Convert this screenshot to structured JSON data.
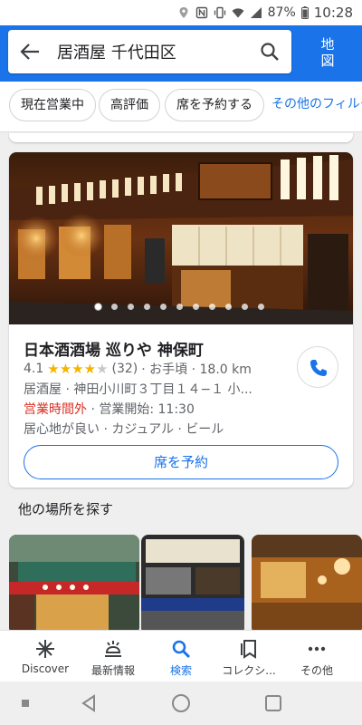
{
  "status_bar": {
    "battery": "87%",
    "time": "10:28"
  },
  "search": {
    "query": "居酒屋 千代田区"
  },
  "map_button": {
    "line1": "地",
    "line2": "図"
  },
  "filters": [
    "現在営業中",
    "高評価",
    "席を予約する",
    "その他のフィルタ"
  ],
  "result": {
    "name": "日本酒酒場 巡りや 神保町",
    "rating": "4.1",
    "rating_value": 4.1,
    "reviews": "(32)",
    "price": "· お手頃 · 18.0 km",
    "category_address": "居酒屋 · 神田小川町３丁目１４−１ 小...",
    "closed": "営業時間外",
    "opening": " · 営業開始: 11:30",
    "features": "居心地が良い · カジュアル · ビール",
    "reserve_label": "席を予約",
    "photo_count": 11,
    "active_photo": 0
  },
  "section": {
    "title": "他の場所を探す"
  },
  "bottom_nav": [
    {
      "label": "Discover",
      "icon": "discover-icon"
    },
    {
      "label": "最新情報",
      "icon": "updates-icon"
    },
    {
      "label": "検索",
      "icon": "search-icon",
      "active": true
    },
    {
      "label": "コレクシ...",
      "icon": "collections-icon"
    },
    {
      "label": "その他",
      "icon": "more-icon"
    }
  ],
  "colors": {
    "accent": "#1a73e8",
    "star": "#f4b400",
    "closed": "#d93025"
  }
}
